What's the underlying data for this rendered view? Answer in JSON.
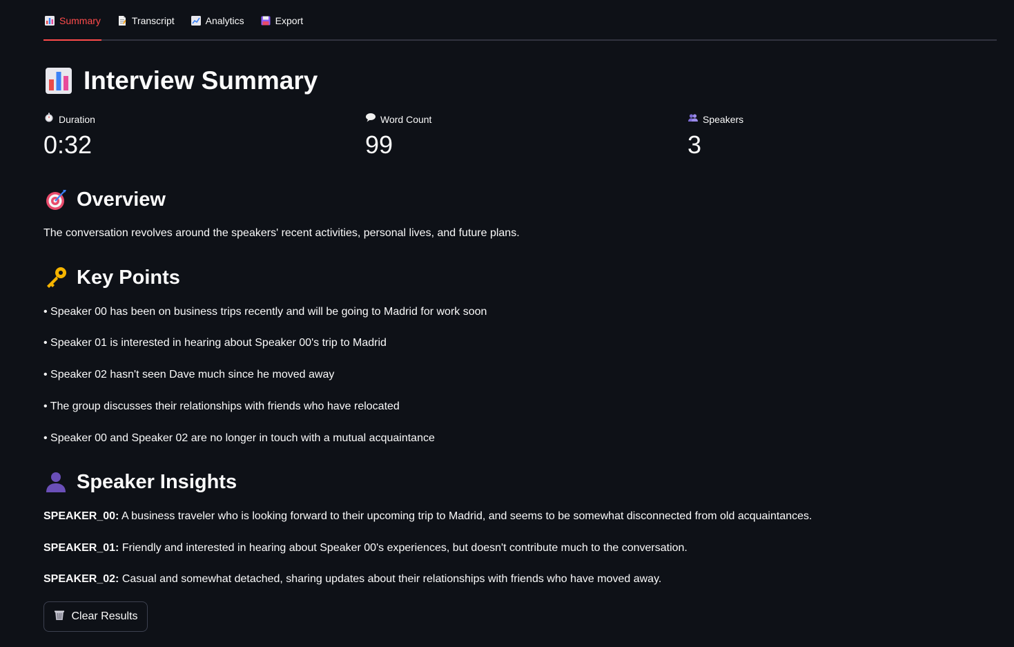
{
  "tabs": [
    {
      "label": "Summary",
      "icon": "bar-chart-icon",
      "active": true
    },
    {
      "label": "Transcript",
      "icon": "page-icon",
      "active": false
    },
    {
      "label": "Analytics",
      "icon": "line-chart-icon",
      "active": false
    },
    {
      "label": "Export",
      "icon": "floppy-disk-icon",
      "active": false
    }
  ],
  "title": "Interview Summary",
  "metrics": [
    {
      "label": "Duration",
      "value": "0:32",
      "icon": "stopwatch-icon"
    },
    {
      "label": "Word Count",
      "value": "99",
      "icon": "speech-bubble-icon"
    },
    {
      "label": "Speakers",
      "value": "3",
      "icon": "people-icon"
    }
  ],
  "overview": {
    "heading": "Overview",
    "text": "The conversation revolves around the speakers' recent activities, personal lives, and future plans."
  },
  "key_points": {
    "heading": "Key Points",
    "items": [
      "• Speaker 00 has been on business trips recently and will be going to Madrid for work soon",
      "• Speaker 01 is interested in hearing about Speaker 00's trip to Madrid",
      "• Speaker 02 hasn't seen Dave much since he moved away",
      "• The group discusses their relationships with friends who have relocated",
      "• Speaker 00 and Speaker 02 are no longer in touch with a mutual acquaintance"
    ]
  },
  "speaker_insights": {
    "heading": "Speaker Insights",
    "items": [
      {
        "speaker": "SPEAKER_00:",
        "text": " A business traveler who is looking forward to their upcoming trip to Madrid, and seems to be somewhat disconnected from old acquaintances."
      },
      {
        "speaker": "SPEAKER_01:",
        "text": " Friendly and interested in hearing about Speaker 00's experiences, but doesn't contribute much to the conversation."
      },
      {
        "speaker": "SPEAKER_02:",
        "text": " Casual and somewhat detached, sharing updates about their relationships with friends who have moved away."
      }
    ]
  },
  "clear_button": {
    "label": "Clear Results",
    "icon": "wastebasket-icon"
  },
  "colors": {
    "background": "#0e1117",
    "accent": "#ff4b4b",
    "text": "#fafafa",
    "border": "#31333f"
  }
}
